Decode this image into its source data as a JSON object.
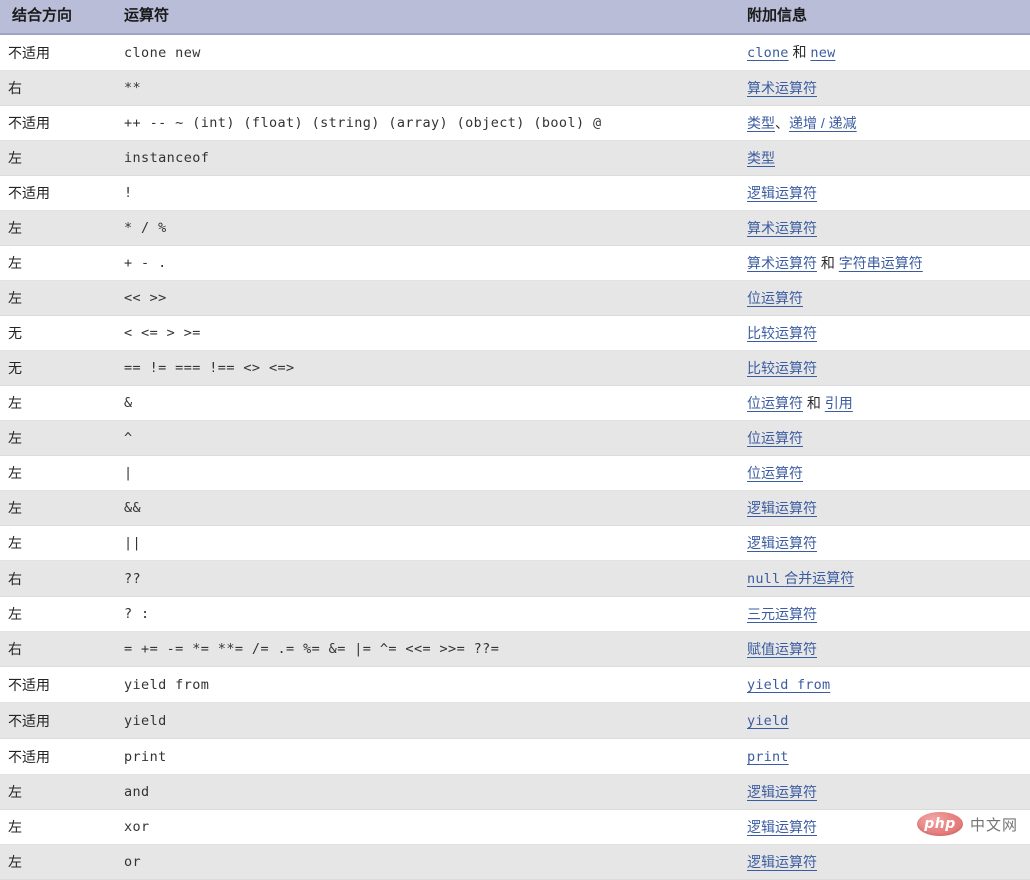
{
  "table": {
    "headers": {
      "associativity": "结合方向",
      "operator": "运算符",
      "additional": "附加信息"
    },
    "rows": [
      {
        "assoc": "不适用",
        "operator": "clone new",
        "info_parts": [
          {
            "text": "clone",
            "type": "link-mono"
          },
          {
            "text": " 和 ",
            "type": "plain"
          },
          {
            "text": "new",
            "type": "link-mono"
          }
        ]
      },
      {
        "assoc": "右",
        "operator": "**",
        "info_parts": [
          {
            "text": "算术运算符",
            "type": "link"
          }
        ]
      },
      {
        "assoc": "不适用",
        "operator": "++ -- ~ (int) (float) (string) (array) (object) (bool) @",
        "info_parts": [
          {
            "text": "类型",
            "type": "link"
          },
          {
            "text": "、",
            "type": "plain"
          },
          {
            "text": "递增 / 递减",
            "type": "link"
          }
        ]
      },
      {
        "assoc": "左",
        "operator": "instanceof",
        "info_parts": [
          {
            "text": "类型",
            "type": "link"
          }
        ]
      },
      {
        "assoc": "不适用",
        "operator": "!",
        "info_parts": [
          {
            "text": "逻辑运算符",
            "type": "link"
          }
        ]
      },
      {
        "assoc": "左",
        "operator": "* / %",
        "info_parts": [
          {
            "text": "算术运算符",
            "type": "link"
          }
        ]
      },
      {
        "assoc": "左",
        "operator": "+ - .",
        "info_parts": [
          {
            "text": "算术运算符",
            "type": "link"
          },
          {
            "text": " 和 ",
            "type": "plain"
          },
          {
            "text": "字符串运算符",
            "type": "link"
          }
        ]
      },
      {
        "assoc": "左",
        "operator": "<< >>",
        "info_parts": [
          {
            "text": "位运算符",
            "type": "link"
          }
        ]
      },
      {
        "assoc": "无",
        "operator": "< <= > >=",
        "info_parts": [
          {
            "text": "比较运算符",
            "type": "link"
          }
        ]
      },
      {
        "assoc": "无",
        "operator": "== != === !== <> <=>",
        "info_parts": [
          {
            "text": "比较运算符",
            "type": "link"
          }
        ]
      },
      {
        "assoc": "左",
        "operator": "&",
        "info_parts": [
          {
            "text": "位运算符",
            "type": "link"
          },
          {
            "text": " 和 ",
            "type": "plain"
          },
          {
            "text": "引用",
            "type": "link"
          }
        ]
      },
      {
        "assoc": "左",
        "operator": "^",
        "info_parts": [
          {
            "text": "位运算符",
            "type": "link"
          }
        ]
      },
      {
        "assoc": "左",
        "operator": "|",
        "info_parts": [
          {
            "text": "位运算符",
            "type": "link"
          }
        ]
      },
      {
        "assoc": "左",
        "operator": "&&",
        "info_parts": [
          {
            "text": "逻辑运算符",
            "type": "link"
          }
        ]
      },
      {
        "assoc": "左",
        "operator": "||",
        "info_parts": [
          {
            "text": "逻辑运算符",
            "type": "link"
          }
        ]
      },
      {
        "assoc": "右",
        "operator": "??",
        "info_parts": [
          {
            "text": "null",
            "type": "link-mono"
          },
          {
            "text": " ",
            "type": "link-plain"
          },
          {
            "text": "合并运算符",
            "type": "link"
          }
        ]
      },
      {
        "assoc": "左",
        "operator": "? :",
        "info_parts": [
          {
            "text": "三元运算符",
            "type": "link"
          }
        ]
      },
      {
        "assoc": "右",
        "operator": "= += -= *= **= /= .= %= &= |= ^= <<= >>= ??=",
        "info_parts": [
          {
            "text": "赋值运算符",
            "type": "link"
          }
        ]
      },
      {
        "assoc": "不适用",
        "operator": "yield from",
        "info_parts": [
          {
            "text": "yield from",
            "type": "link-mono"
          }
        ]
      },
      {
        "assoc": "不适用",
        "operator": "yield",
        "info_parts": [
          {
            "text": "yield",
            "type": "link-mono"
          }
        ]
      },
      {
        "assoc": "不适用",
        "operator": "print",
        "info_parts": [
          {
            "text": "print",
            "type": "link-mono"
          }
        ]
      },
      {
        "assoc": "左",
        "operator": "and",
        "info_parts": [
          {
            "text": "逻辑运算符",
            "type": "link"
          }
        ]
      },
      {
        "assoc": "左",
        "operator": "xor",
        "info_parts": [
          {
            "text": "逻辑运算符",
            "type": "link"
          }
        ]
      },
      {
        "assoc": "左",
        "operator": "or",
        "info_parts": [
          {
            "text": "逻辑运算符",
            "type": "link"
          }
        ]
      }
    ]
  },
  "watermark": {
    "badge": "php",
    "label": "中文网"
  },
  "colors": {
    "header_bg": "#b9bdd8",
    "row_alt_bg": "#e6e6e6",
    "link": "#3b5ca0",
    "watermark_badge": "#e0706f"
  }
}
